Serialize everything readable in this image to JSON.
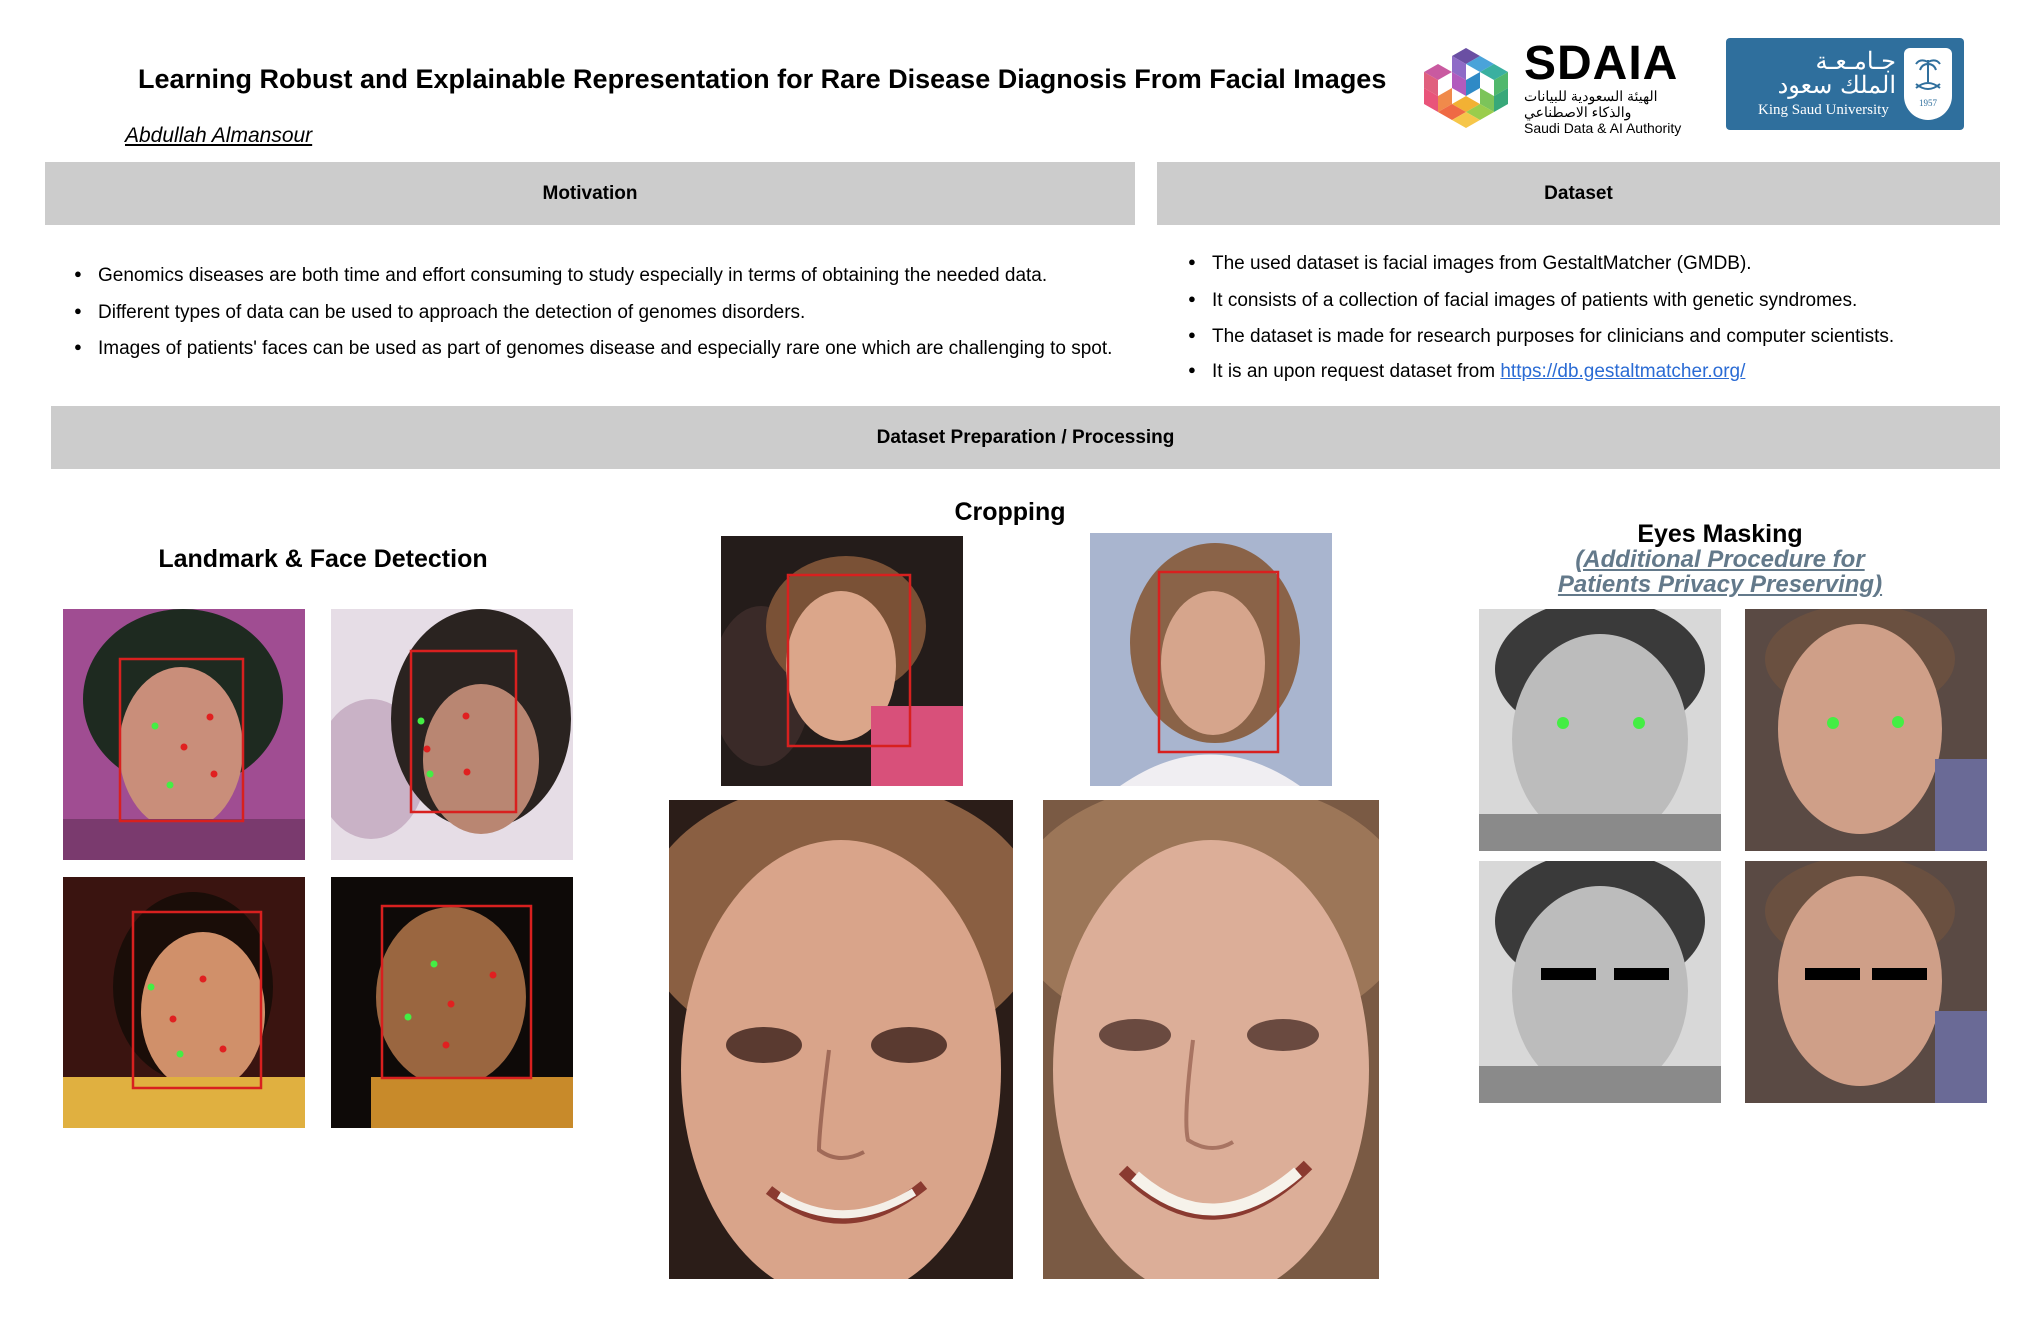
{
  "header": {
    "title": "Learning Robust and Explainable Representation for Rare Disease Diagnosis From Facial Images",
    "author": "Abdullah Almansour"
  },
  "logos": {
    "sdaia": {
      "name": "SDAIA",
      "arabic_line1": "الهيئة السعودية للبيانات",
      "arabic_line2": "والذكاء الاصطناعي",
      "english": "Saudi Data & AI Authority"
    },
    "ksu": {
      "arabic_line1": "جـامـعـة",
      "arabic_line2": "الملك سعود",
      "english": "King Saud University",
      "year": "1957"
    }
  },
  "motivation": {
    "heading": "Motivation",
    "items": [
      "Genomics diseases are both time and effort consuming to study especially in terms of obtaining the needed data.",
      "Different types of data can be used to approach the detection of genomes disorders.",
      "Images of patients' faces can be used as part of genomes disease and especially rare one which are challenging to spot."
    ]
  },
  "dataset": {
    "heading": "Dataset",
    "items": [
      "The used dataset is facial images from GestaltMatcher (GMDB).",
      "It consists of a collection of facial images of patients with genetic syndromes.",
      "The dataset is made for research purposes for clinicians and computer scientists."
    ],
    "last_item_prefix": "It is an upon request dataset from ",
    "link_text": "https://db.gestaltmatcher.org/"
  },
  "preparation": {
    "heading": "Dataset Preparation / Processing",
    "landmark": {
      "title": "Landmark & Face Detection"
    },
    "cropping": {
      "title": "Cropping"
    },
    "eyes": {
      "title": "Eyes Masking",
      "subtitle_line1": "(Additional Procedure for",
      "subtitle_line2": "Patients Privacy Preserving)"
    }
  },
  "colors": {
    "header_bar": "#cccccc",
    "detection_box": "#d8201f",
    "landmark_green": "#44ee44",
    "landmark_red": "#e02020",
    "ksu_blue": "#2f6f9d",
    "link": "#2a6bd4",
    "subtitle": "#63798a"
  }
}
